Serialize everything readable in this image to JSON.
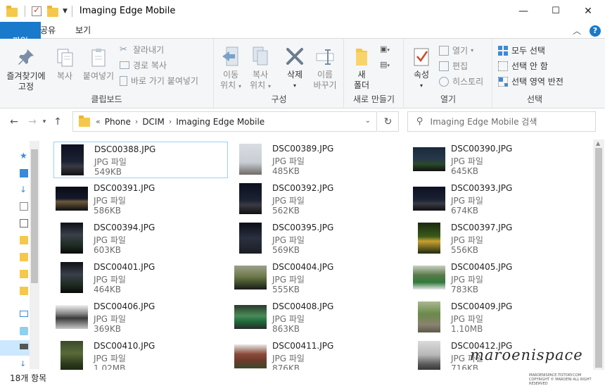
{
  "window": {
    "title": "Imaging Edge Mobile",
    "minimize": "—",
    "maximize": "☐",
    "close": "✕"
  },
  "ribbon_tabs": [
    {
      "label": "파일"
    },
    {
      "label": "홈"
    },
    {
      "label": "공유"
    },
    {
      "label": "보기"
    }
  ],
  "ribbon": {
    "clipboard": {
      "pin_label_1": "즐겨찾기에",
      "pin_label_2": "고정",
      "copy": "복사",
      "paste": "붙여넣기",
      "cut": "잘라내기",
      "copy_path": "경로 복사",
      "paste_shortcut": "바로 가기 붙여넣기",
      "group": "클립보드"
    },
    "organize": {
      "move_1": "이동",
      "move_2": "위치",
      "copy_1": "복사",
      "copy_2": "위치",
      "delete": "삭제",
      "rename_1": "이름",
      "rename_2": "바꾸기",
      "group": "구성"
    },
    "new": {
      "new_folder_1": "새",
      "new_folder_2": "폴더",
      "group": "새로 만들기"
    },
    "open": {
      "properties": "속성",
      "open": "열기",
      "edit": "편집",
      "history": "히스토리",
      "group": "열기"
    },
    "select": {
      "select_all": "모두 선택",
      "select_none": "선택 안 함",
      "invert": "선택 영역 반전",
      "group": "선택"
    }
  },
  "address": {
    "overflow": "«",
    "crumbs": [
      "Phone",
      "DCIM",
      "Imaging Edge Mobile"
    ],
    "search_placeholder": "Imaging Edge Mobile 검색"
  },
  "files": [
    {
      "name": "DSC00388.JPG",
      "type": "JPG 파일",
      "size": "549KB",
      "orient": "p",
      "scene": "night-city",
      "selected": true
    },
    {
      "name": "DSC00389.JPG",
      "type": "JPG 파일",
      "size": "485KB",
      "orient": "p",
      "scene": "tower"
    },
    {
      "name": "DSC00390.JPG",
      "type": "JPG 파일",
      "size": "645KB",
      "orient": "l",
      "scene": "bridge"
    },
    {
      "name": "DSC00391.JPG",
      "type": "JPG 파일",
      "size": "586KB",
      "orient": "l",
      "scene": "night-road"
    },
    {
      "name": "DSC00392.JPG",
      "type": "JPG 파일",
      "size": "562KB",
      "orient": "p",
      "scene": "night-city"
    },
    {
      "name": "DSC00393.JPG",
      "type": "JPG 파일",
      "size": "674KB",
      "orient": "l",
      "scene": "night-city"
    },
    {
      "name": "DSC00394.JPG",
      "type": "JPG 파일",
      "size": "603KB",
      "orient": "p",
      "scene": "night-tree"
    },
    {
      "name": "DSC00395.JPG",
      "type": "JPG 파일",
      "size": "569KB",
      "orient": "p",
      "scene": "night-building"
    },
    {
      "name": "DSC00397.JPG",
      "type": "JPG 파일",
      "size": "556KB",
      "orient": "p",
      "scene": "flowers"
    },
    {
      "name": "DSC00401.JPG",
      "type": "JPG 파일",
      "size": "464KB",
      "orient": "p",
      "scene": "night-tree"
    },
    {
      "name": "DSC00404.JPG",
      "type": "JPG 파일",
      "size": "555KB",
      "orient": "l",
      "scene": "trees"
    },
    {
      "name": "DSC00405.JPG",
      "type": "JPG 파일",
      "size": "783KB",
      "orient": "l",
      "scene": "field"
    },
    {
      "name": "DSC00406.JPG",
      "type": "JPG 파일",
      "size": "369KB",
      "orient": "l",
      "scene": "overpass"
    },
    {
      "name": "DSC00408.JPG",
      "type": "JPG 파일",
      "size": "863KB",
      "orient": "l",
      "scene": "green-sign"
    },
    {
      "name": "DSC00409.JPG",
      "type": "JPG 파일",
      "size": "1.10MB",
      "orient": "p",
      "scene": "path"
    },
    {
      "name": "DSC00410.JPG",
      "type": "JPG 파일",
      "size": "1.02MB",
      "orient": "p",
      "scene": "forest"
    },
    {
      "name": "DSC00411.JPG",
      "type": "JPG 파일",
      "size": "876KB",
      "orient": "l",
      "scene": "brick"
    },
    {
      "name": "DSC00412.JPG",
      "type": "JPG 파일",
      "size": "716KB",
      "orient": "p",
      "scene": "street"
    }
  ],
  "status": {
    "count": "18개 항목"
  },
  "watermark": {
    "script": "maroenispace",
    "small_1": "MAROENISPACE.TISTORY.COM",
    "small_2": "COPYRIGHT © MAROENI ALL RIGHT RESERVED"
  }
}
